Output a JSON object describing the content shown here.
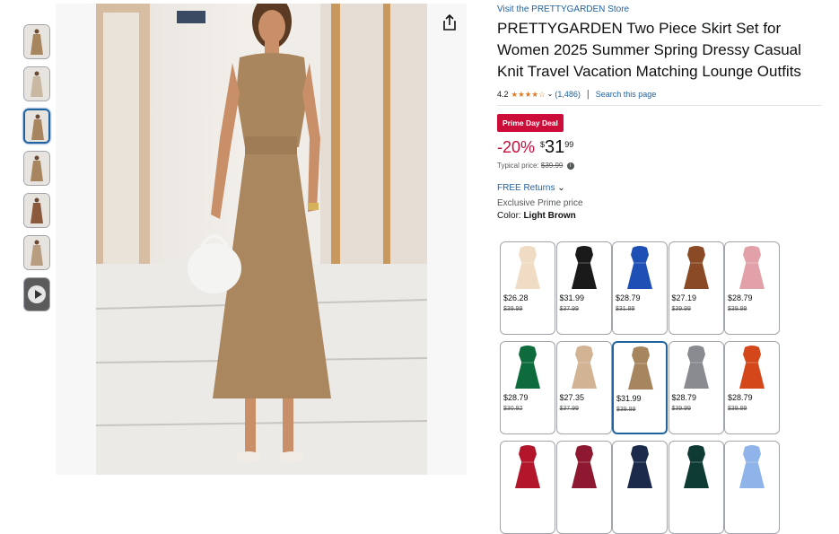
{
  "thumbnails": [
    {
      "name": "thumb-1",
      "color": "#a7865f",
      "active": false
    },
    {
      "name": "thumb-2",
      "color": "#c9b8a2",
      "active": false
    },
    {
      "name": "thumb-3",
      "color": "#a7865f",
      "active": true
    },
    {
      "name": "thumb-4",
      "color": "#a7865f",
      "active": false
    },
    {
      "name": "thumb-5",
      "color": "#8b5a3c",
      "active": false
    },
    {
      "name": "thumb-6",
      "color": "#b99d80",
      "active": false
    },
    {
      "name": "thumb-video",
      "color": "#5b5b5b",
      "active": false,
      "video": true
    }
  ],
  "product": {
    "store_link": "Visit the PRETTYGARDEN Store",
    "title": "PRETTYGARDEN Two Piece Skirt Set for Women 2025 Summer Spring Dressy Casual Knit Travel Vacation Matching Lounge Outfits",
    "rating": "4.2",
    "stars": "★★★★☆",
    "review_count": "(1,486)",
    "search_link": "Search this page",
    "deal_badge": "Prime Day Deal",
    "discount": "-20%",
    "currency": "$",
    "price_whole": "31",
    "price_fraction": "99",
    "typical_label": "Typical price: ",
    "typical_price": "$39.99",
    "returns": "FREE Returns",
    "exclusive": "Exclusive Prime price",
    "color_label": "Color: ",
    "color_value": "Light Brown"
  },
  "colors": {
    "accent_link": "#2162a1",
    "deal_red": "#cc0c39",
    "star_orange": "#de7921"
  },
  "swatches": [
    {
      "color": "#f0dcc4",
      "price": "$26.28",
      "orig": "$39.99"
    },
    {
      "color": "#1a1a1a",
      "price": "$31.99",
      "orig": "$37.99"
    },
    {
      "color": "#1e4fb5",
      "price": "$28.79",
      "orig": "$31.99"
    },
    {
      "color": "#8a4a26",
      "price": "$27.19",
      "orig": "$39.99"
    },
    {
      "color": "#e2a1a8",
      "price": "$28.79",
      "orig": "$39.99"
    },
    {
      "color": "#0d6b3c",
      "price": "$28.79",
      "orig": "$30.92"
    },
    {
      "color": "#d2b394",
      "price": "$27.35",
      "orig": "$37.99"
    },
    {
      "color": "#a7865f",
      "price": "$31.99",
      "orig": "$39.99",
      "selected": true
    },
    {
      "color": "#8a8b90",
      "price": "$28.79",
      "orig": "$39.99"
    },
    {
      "color": "#d4471a",
      "price": "$28.79",
      "orig": "$39.99"
    },
    {
      "color": "#b3162b",
      "price": "",
      "orig": ""
    },
    {
      "color": "#8e1830",
      "price": "",
      "orig": ""
    },
    {
      "color": "#1b2a4a",
      "price": "",
      "orig": ""
    },
    {
      "color": "#0e3b34",
      "price": "",
      "orig": ""
    },
    {
      "color": "#8fb4ea",
      "price": "",
      "orig": ""
    }
  ]
}
